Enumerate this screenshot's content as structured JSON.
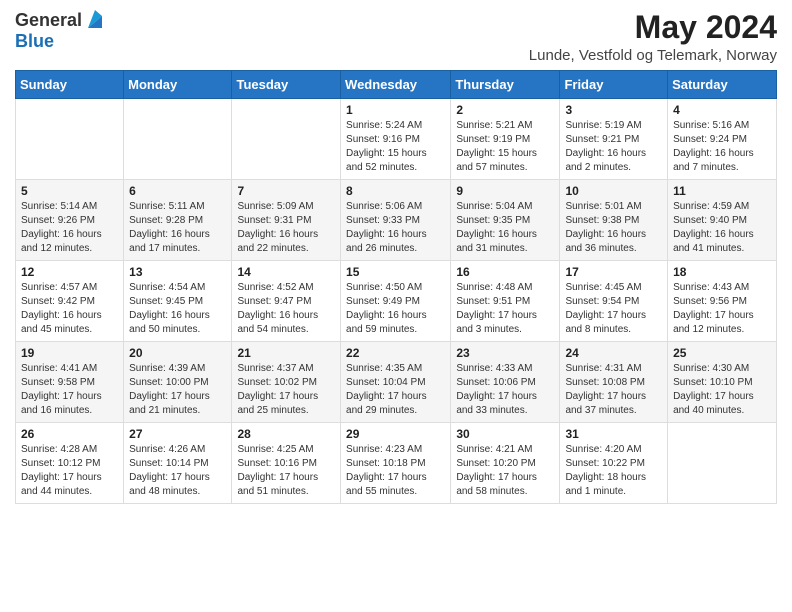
{
  "header": {
    "logo_line1": "General",
    "logo_line2": "Blue",
    "month": "May 2024",
    "location": "Lunde, Vestfold og Telemark, Norway"
  },
  "columns": [
    "Sunday",
    "Monday",
    "Tuesday",
    "Wednesday",
    "Thursday",
    "Friday",
    "Saturday"
  ],
  "weeks": [
    [
      {
        "day": "",
        "info": ""
      },
      {
        "day": "",
        "info": ""
      },
      {
        "day": "",
        "info": ""
      },
      {
        "day": "1",
        "info": "Sunrise: 5:24 AM\nSunset: 9:16 PM\nDaylight: 15 hours and 52 minutes."
      },
      {
        "day": "2",
        "info": "Sunrise: 5:21 AM\nSunset: 9:19 PM\nDaylight: 15 hours and 57 minutes."
      },
      {
        "day": "3",
        "info": "Sunrise: 5:19 AM\nSunset: 9:21 PM\nDaylight: 16 hours and 2 minutes."
      },
      {
        "day": "4",
        "info": "Sunrise: 5:16 AM\nSunset: 9:24 PM\nDaylight: 16 hours and 7 minutes."
      }
    ],
    [
      {
        "day": "5",
        "info": "Sunrise: 5:14 AM\nSunset: 9:26 PM\nDaylight: 16 hours and 12 minutes."
      },
      {
        "day": "6",
        "info": "Sunrise: 5:11 AM\nSunset: 9:28 PM\nDaylight: 16 hours and 17 minutes."
      },
      {
        "day": "7",
        "info": "Sunrise: 5:09 AM\nSunset: 9:31 PM\nDaylight: 16 hours and 22 minutes."
      },
      {
        "day": "8",
        "info": "Sunrise: 5:06 AM\nSunset: 9:33 PM\nDaylight: 16 hours and 26 minutes."
      },
      {
        "day": "9",
        "info": "Sunrise: 5:04 AM\nSunset: 9:35 PM\nDaylight: 16 hours and 31 minutes."
      },
      {
        "day": "10",
        "info": "Sunrise: 5:01 AM\nSunset: 9:38 PM\nDaylight: 16 hours and 36 minutes."
      },
      {
        "day": "11",
        "info": "Sunrise: 4:59 AM\nSunset: 9:40 PM\nDaylight: 16 hours and 41 minutes."
      }
    ],
    [
      {
        "day": "12",
        "info": "Sunrise: 4:57 AM\nSunset: 9:42 PM\nDaylight: 16 hours and 45 minutes."
      },
      {
        "day": "13",
        "info": "Sunrise: 4:54 AM\nSunset: 9:45 PM\nDaylight: 16 hours and 50 minutes."
      },
      {
        "day": "14",
        "info": "Sunrise: 4:52 AM\nSunset: 9:47 PM\nDaylight: 16 hours and 54 minutes."
      },
      {
        "day": "15",
        "info": "Sunrise: 4:50 AM\nSunset: 9:49 PM\nDaylight: 16 hours and 59 minutes."
      },
      {
        "day": "16",
        "info": "Sunrise: 4:48 AM\nSunset: 9:51 PM\nDaylight: 17 hours and 3 minutes."
      },
      {
        "day": "17",
        "info": "Sunrise: 4:45 AM\nSunset: 9:54 PM\nDaylight: 17 hours and 8 minutes."
      },
      {
        "day": "18",
        "info": "Sunrise: 4:43 AM\nSunset: 9:56 PM\nDaylight: 17 hours and 12 minutes."
      }
    ],
    [
      {
        "day": "19",
        "info": "Sunrise: 4:41 AM\nSunset: 9:58 PM\nDaylight: 17 hours and 16 minutes."
      },
      {
        "day": "20",
        "info": "Sunrise: 4:39 AM\nSunset: 10:00 PM\nDaylight: 17 hours and 21 minutes."
      },
      {
        "day": "21",
        "info": "Sunrise: 4:37 AM\nSunset: 10:02 PM\nDaylight: 17 hours and 25 minutes."
      },
      {
        "day": "22",
        "info": "Sunrise: 4:35 AM\nSunset: 10:04 PM\nDaylight: 17 hours and 29 minutes."
      },
      {
        "day": "23",
        "info": "Sunrise: 4:33 AM\nSunset: 10:06 PM\nDaylight: 17 hours and 33 minutes."
      },
      {
        "day": "24",
        "info": "Sunrise: 4:31 AM\nSunset: 10:08 PM\nDaylight: 17 hours and 37 minutes."
      },
      {
        "day": "25",
        "info": "Sunrise: 4:30 AM\nSunset: 10:10 PM\nDaylight: 17 hours and 40 minutes."
      }
    ],
    [
      {
        "day": "26",
        "info": "Sunrise: 4:28 AM\nSunset: 10:12 PM\nDaylight: 17 hours and 44 minutes."
      },
      {
        "day": "27",
        "info": "Sunrise: 4:26 AM\nSunset: 10:14 PM\nDaylight: 17 hours and 48 minutes."
      },
      {
        "day": "28",
        "info": "Sunrise: 4:25 AM\nSunset: 10:16 PM\nDaylight: 17 hours and 51 minutes."
      },
      {
        "day": "29",
        "info": "Sunrise: 4:23 AM\nSunset: 10:18 PM\nDaylight: 17 hours and 55 minutes."
      },
      {
        "day": "30",
        "info": "Sunrise: 4:21 AM\nSunset: 10:20 PM\nDaylight: 17 hours and 58 minutes."
      },
      {
        "day": "31",
        "info": "Sunrise: 4:20 AM\nSunset: 10:22 PM\nDaylight: 18 hours and 1 minute."
      },
      {
        "day": "",
        "info": ""
      }
    ]
  ]
}
